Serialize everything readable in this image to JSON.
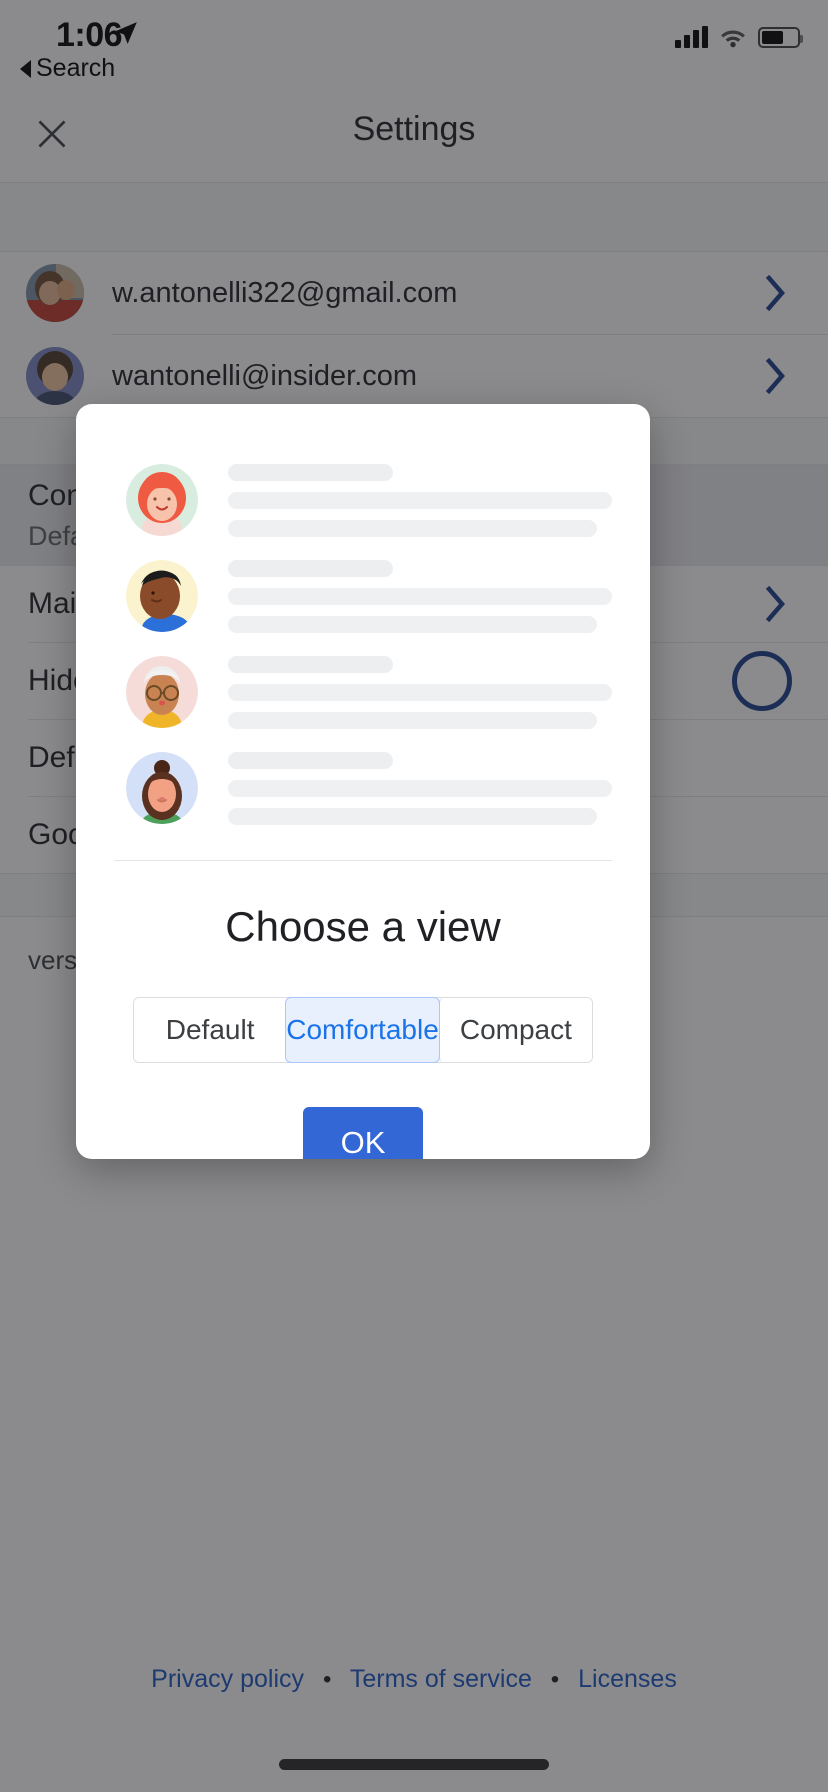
{
  "status_bar": {
    "time": "1:06",
    "back_label": "Search",
    "location_icon": "location-arrow-icon",
    "signal_icon": "cellular-bars-icon",
    "wifi_icon": "wifi-icon",
    "battery_icon": "battery-icon"
  },
  "app_bar": {
    "close_icon": "close-icon",
    "title": "Settings"
  },
  "accounts": [
    {
      "email": "w.antonelli322@gmail.com",
      "avatar": "user-photo-avatar",
      "chevron": "chevron-right-icon"
    },
    {
      "email": "wantonelli@insider.com",
      "avatar": "user-photo-avatar",
      "chevron": "chevron-right-icon"
    }
  ],
  "settings_rows": [
    {
      "label": "Conversation view",
      "sublabel": "Default view",
      "type": "highlight"
    },
    {
      "label": "Mail swipe actions",
      "sublabel": "",
      "type": "chevron"
    },
    {
      "label": "Hide images",
      "sublabel": "",
      "type": "toggle"
    },
    {
      "label": "Default action",
      "sublabel": "",
      "type": "plain"
    },
    {
      "label": "Google apps",
      "sublabel": "",
      "type": "plain"
    }
  ],
  "version_text": "version ",
  "footer": {
    "links": [
      "Privacy policy",
      "Terms of service",
      "Licenses"
    ],
    "separator": "•"
  },
  "dialog": {
    "title": "Choose a view",
    "preview_rows": [
      {
        "avatar": "illustration-avatar-red-hair"
      },
      {
        "avatar": "illustration-avatar-short-hair"
      },
      {
        "avatar": "illustration-avatar-glasses"
      },
      {
        "avatar": "illustration-avatar-bun"
      }
    ],
    "options": [
      {
        "label": "Default",
        "selected": false
      },
      {
        "label": "Comfortable",
        "selected": true
      },
      {
        "label": "Compact",
        "selected": false
      }
    ],
    "ok_label": "OK"
  },
  "colors": {
    "accent_blue": "#1a73e8",
    "ok_button": "#3367d6",
    "selected_bg": "#e8f0fe",
    "selected_border": "#a8c7fa",
    "link_blue": "#1a56c5",
    "scrim": "rgba(32,33,36,0.52)"
  }
}
